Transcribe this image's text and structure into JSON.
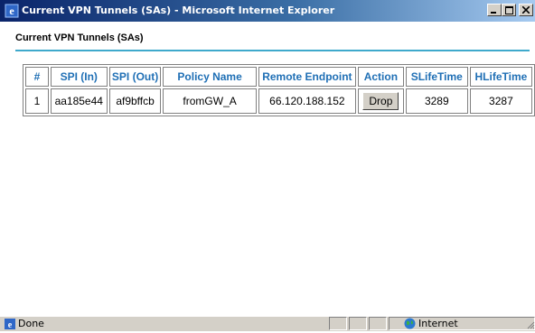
{
  "window": {
    "title": "Current VPN Tunnels (SAs) - Microsoft Internet Explorer",
    "icon": "ie-icon",
    "controls": {
      "minimize": "minimize-icon",
      "maximize": "maximize-icon",
      "close": "close-icon"
    }
  },
  "page": {
    "heading": "Current VPN Tunnels (SAs)",
    "accent_color": "#3fa9cc",
    "header_text_color": "#1f6fb5"
  },
  "table": {
    "columns": [
      "#",
      "SPI (In)",
      "SPI (Out)",
      "Policy Name",
      "Remote Endpoint",
      "Action",
      "SLifeTime",
      "HLifeTime"
    ],
    "rows": [
      {
        "num": "1",
        "spi_in": "aa185e44",
        "spi_out": "af9bffcb",
        "policy": "fromGW_A",
        "remote": "66.120.188.152",
        "action": "Drop",
        "slife": "3289",
        "hlife": "3287"
      }
    ]
  },
  "statusbar": {
    "status": "Done",
    "zone": "Internet",
    "zone_icon": "globe-icon"
  }
}
